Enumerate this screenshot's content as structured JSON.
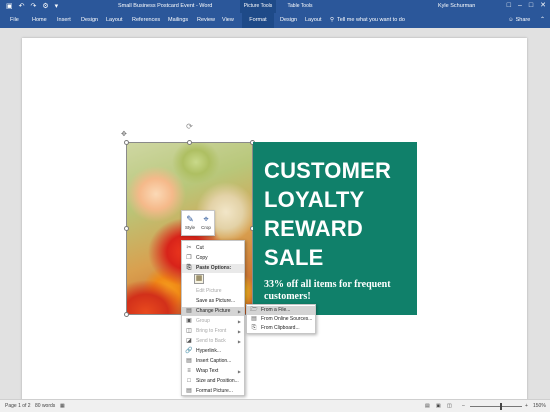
{
  "titlebar": {
    "title": "Small Business Postcard Event - Word",
    "context_picture": "Picture Tools",
    "context_table": "Table Tools",
    "user": "Kyle Schurman",
    "qat": [
      "▣",
      "↶",
      "↷",
      "⚙",
      "▾"
    ],
    "win": [
      "□",
      "–",
      "□",
      "✕"
    ]
  },
  "tabs": {
    "file": "File",
    "home": "Home",
    "insert": "Insert",
    "design": "Design",
    "layout": "Layout",
    "references": "References",
    "mailings": "Mailings",
    "review": "Review",
    "view": "View",
    "format": "Format",
    "design2": "Design",
    "layout2": "Layout",
    "tellme": "Tell me what you want to do",
    "share": "Share"
  },
  "postcard": {
    "headline": [
      "CUSTOMER",
      "LOYALTY",
      "REWARD",
      "SALE"
    ],
    "sub": "33% off all items for frequent customers!"
  },
  "minibar": {
    "style": "Style",
    "crop": "Crop"
  },
  "contextmenu": {
    "cut": "Cut",
    "copy": "Copy",
    "paste_options": "Paste Options:",
    "edit_picture": "Edit Picture",
    "save_as_picture": "Save as Picture...",
    "change_picture": "Change Picture",
    "group": "Group",
    "bring_to_front": "Bring to Front",
    "send_to_back": "Send to Back",
    "hyperlink": "Hyperlink...",
    "insert_caption": "Insert Caption...",
    "wrap_text": "Wrap Text",
    "size_and_position": "Size and Position...",
    "format_picture": "Format Picture..."
  },
  "submenu": {
    "from_file": "From a File...",
    "from_online": "From Online Sources...",
    "from_clipboard": "From Clipboard..."
  },
  "status": {
    "page": "Page 1 of 2",
    "words": "80 words",
    "zoom": "150%",
    "zoom_fraction": 0.6
  }
}
